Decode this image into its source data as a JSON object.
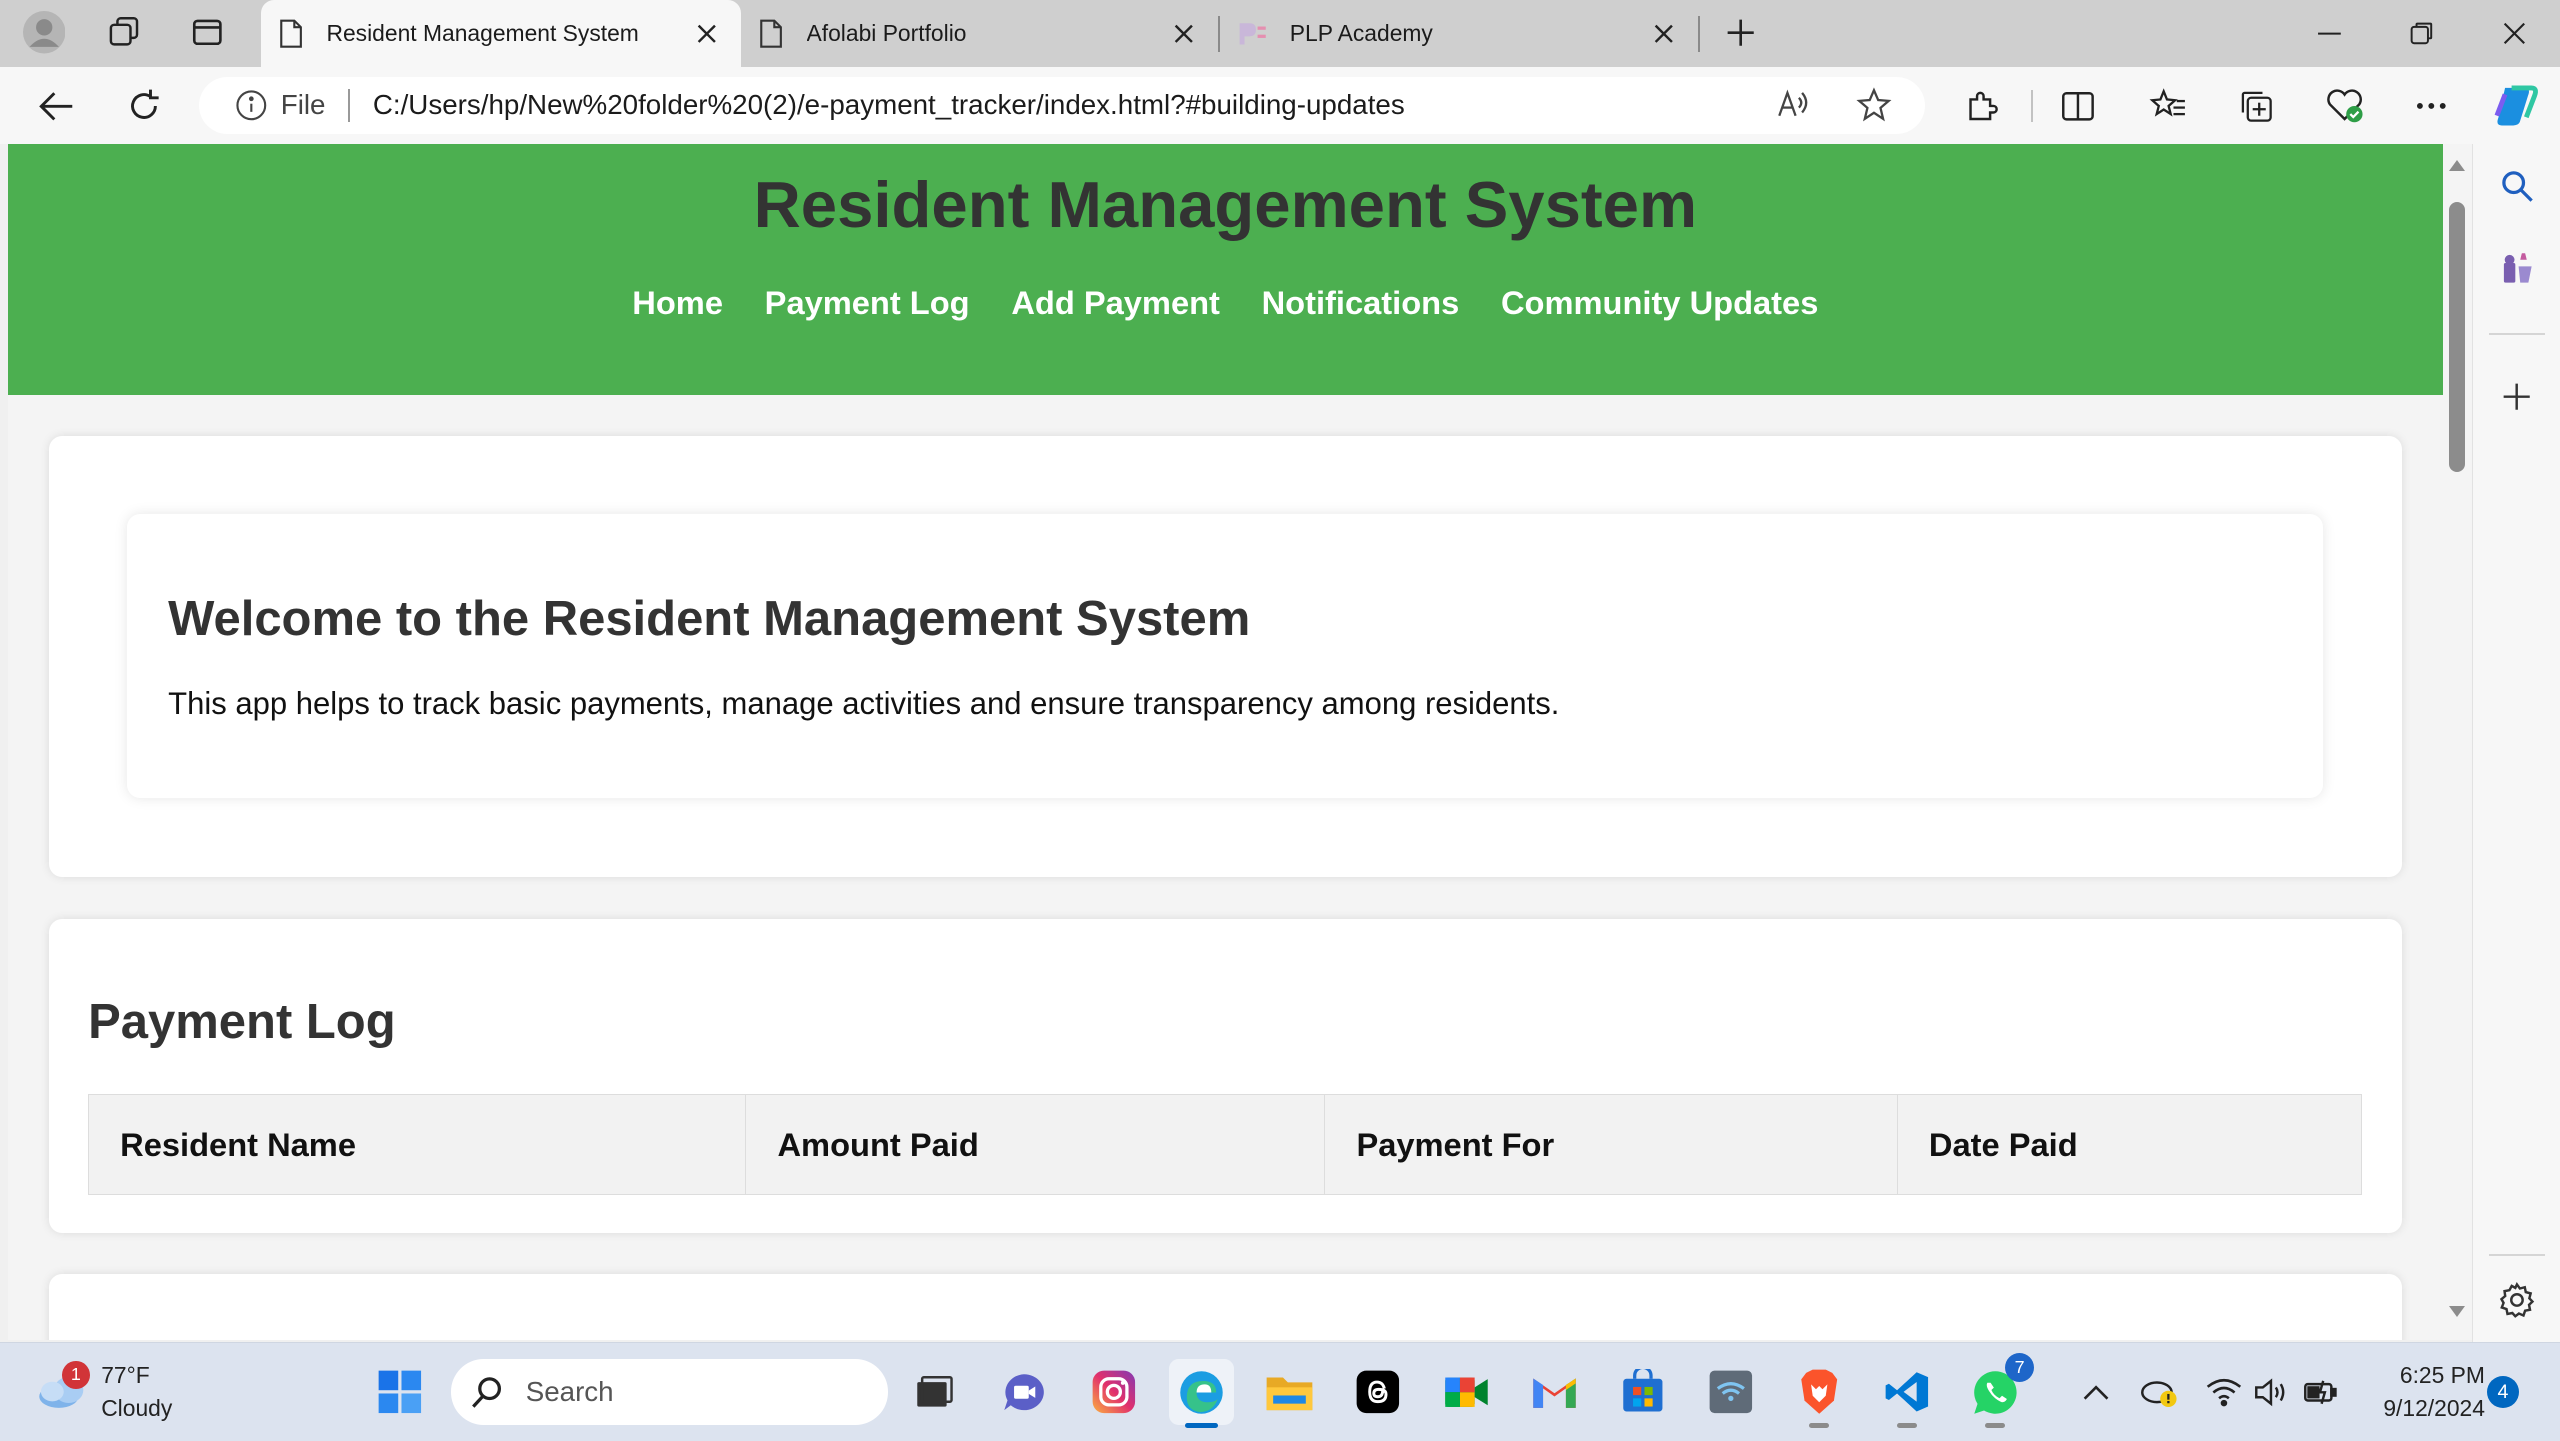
{
  "browser": {
    "tabs": [
      {
        "title": "Resident Management System",
        "active": true
      },
      {
        "title": "Afolabi Portfolio",
        "active": false
      },
      {
        "title": "PLP Academy",
        "active": false
      }
    ],
    "address_file_label": "File",
    "address_url": "C:/Users/hp/New%20folder%20(2)/e-payment_tracker/index.html?#building-updates"
  },
  "page": {
    "title": "Resident Management System",
    "nav": [
      "Home",
      "Payment Log",
      "Add Payment",
      "Notifications",
      "Community Updates"
    ],
    "welcome": {
      "heading": "Welcome to the Resident Management System",
      "text": "This app helps to track basic payments, manage activities and ensure transparency among residents."
    },
    "payment_log": {
      "heading": "Payment Log",
      "columns": [
        "Resident Name",
        "Amount Paid",
        "Payment For",
        "Date Paid"
      ]
    }
  },
  "taskbar": {
    "weather_temp": "77°F",
    "weather_desc": "Cloudy",
    "weather_badge": "1",
    "search_placeholder": "Search",
    "whatsapp_badge": "7",
    "time": "6:25 PM",
    "date": "9/12/2024",
    "notification_count": "4"
  },
  "colors": {
    "header_green": "#4caf50",
    "heading_text": "#333333"
  }
}
